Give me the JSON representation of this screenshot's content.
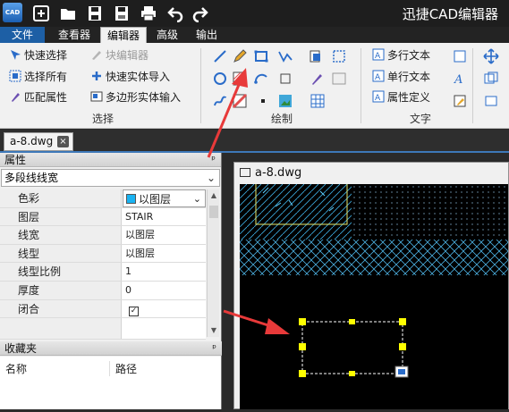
{
  "app": {
    "logo": "CAD",
    "title": "迅捷CAD编辑器"
  },
  "quick_access": [
    "add-icon",
    "open-folder-icon",
    "save-icon",
    "save-as-icon",
    "print-icon",
    "undo-icon",
    "redo-icon"
  ],
  "ribbon_tabs": [
    "文件",
    "查看器",
    "编辑器",
    "高级",
    "输出"
  ],
  "ribbon_active_tab": "编辑器",
  "ribbon": {
    "select_group": {
      "label": "选择",
      "buttons": [
        "快速选择",
        "选择所有",
        "匹配属性",
        "块编辑器",
        "快速实体导入",
        "多边形实体输入"
      ]
    },
    "draw_group": {
      "label": "绘制"
    },
    "text_group": {
      "label": "文字",
      "buttons": [
        "多行文本",
        "单行文本",
        "属性定义"
      ]
    }
  },
  "document_tab": {
    "name": "a-8.dwg",
    "close": "×"
  },
  "properties": {
    "header": "属性",
    "pin": "ᵖ",
    "object_type": "多段线线宽",
    "rows": [
      {
        "name": "色彩",
        "value": "以图层"
      },
      {
        "name": "图层",
        "value": "STAIR"
      },
      {
        "name": "线宽",
        "value": "以图层"
      },
      {
        "name": "线型",
        "value": "以图层"
      },
      {
        "name": "线型比例",
        "value": "1"
      },
      {
        "name": "厚度",
        "value": "0"
      },
      {
        "name": "闭合",
        "value": "✓"
      }
    ],
    "color_swatch": "#19b3f2"
  },
  "favorites": {
    "header": "收藏夹",
    "pin": "ᵖ",
    "columns": [
      "名称",
      "路径"
    ]
  },
  "drawing_window": {
    "title": "a-8.dwg"
  },
  "colors": {
    "file_tab": "#1d5fa5",
    "accent_red": "#e83a3a",
    "grip_yellow": "#ffff00"
  }
}
